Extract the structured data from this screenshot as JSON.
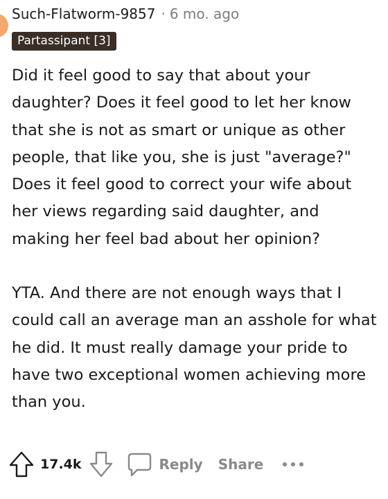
{
  "comment": {
    "username": "Such-Flatworm-9857",
    "separator": "·",
    "age": "6 mo. ago",
    "flair": "Partassipant [3]",
    "paragraphs": [
      "Did it feel good to say that about your daughter? Does it feel good to let her know that she is not as smart or unique as other people, that like you, she is just \"average?\" Does it feel good to correct your wife about her views regarding said daughter, and making her feel bad about her opinion?",
      "YTA. And there are not enough ways that I could call an average man an asshole for what he did. It must really damage your pride to have two exceptional women achieving more than you."
    ]
  },
  "actions": {
    "upvote_icon": "upvote-arrow-icon",
    "vote_count": "17.4k",
    "downvote_icon": "downvote-arrow-icon",
    "reply_icon": "speech-bubble-icon",
    "reply_label": "Reply",
    "share_label": "Share",
    "more_icon": "ellipsis-icon"
  },
  "colors": {
    "text": "#1a1a1b",
    "muted": "#7c7c7c",
    "action_gray": "#878a8c",
    "flair_bg": "#3a2e27",
    "flair_text": "#ffffff",
    "avatar": "#f5a86a"
  }
}
